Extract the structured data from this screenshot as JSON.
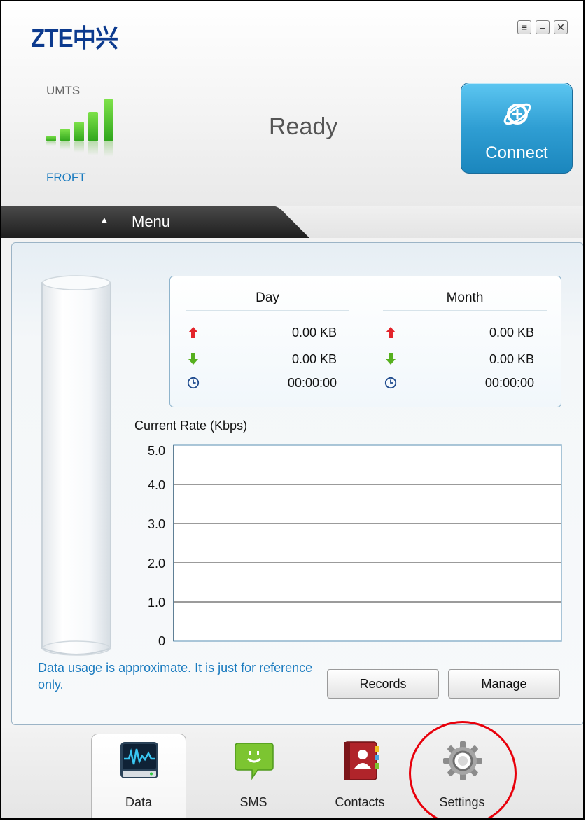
{
  "app": {
    "logo_text": "ZTE中兴"
  },
  "window_controls": {
    "menu_symbol": "≡",
    "minimize_symbol": "–",
    "close_symbol": "✕"
  },
  "status": {
    "network_type": "UMTS",
    "operator": "FROFT",
    "connection_state": "Ready",
    "signal_bars_filled": 5,
    "signal_bars_total": 5
  },
  "connect": {
    "label": "Connect"
  },
  "menu": {
    "label": "Menu",
    "arrow": "▲"
  },
  "usage": {
    "columns": [
      {
        "header": "Day",
        "upload": "0.00 KB",
        "download": "0.00 KB",
        "duration": "00:00:00"
      },
      {
        "header": "Month",
        "upload": "0.00 KB",
        "download": "0.00 KB",
        "duration": "00:00:00"
      }
    ]
  },
  "rate": {
    "label": "Current Rate (Kbps)"
  },
  "chart_data": {
    "type": "line",
    "title": "Current Rate (Kbps)",
    "xlabel": "",
    "ylabel": "",
    "ylim": [
      0,
      5.0
    ],
    "y_ticks": [
      "5.0",
      "4.0",
      "3.0",
      "2.0",
      "1.0",
      "0"
    ],
    "series": [],
    "grid": true
  },
  "note": {
    "text": "Data usage is approximate. It is just for reference only."
  },
  "buttons": {
    "records": "Records",
    "manage": "Manage"
  },
  "nav": {
    "items": [
      {
        "label": "Data",
        "icon": "data-monitor-icon",
        "active": true
      },
      {
        "label": "SMS",
        "icon": "sms-icon",
        "active": false
      },
      {
        "label": "Contacts",
        "icon": "contacts-book-icon",
        "active": false
      },
      {
        "label": "Settings",
        "icon": "gear-icon",
        "active": false
      }
    ]
  },
  "colors": {
    "brand_blue": "#0c3a8e",
    "accent_blue": "#1a7bbf",
    "connect_blue": "#2f9ed3",
    "signal_green": "#3cb521",
    "upload_red": "#e3242b",
    "download_green": "#56b01e",
    "highlight_red": "#e8000b"
  }
}
